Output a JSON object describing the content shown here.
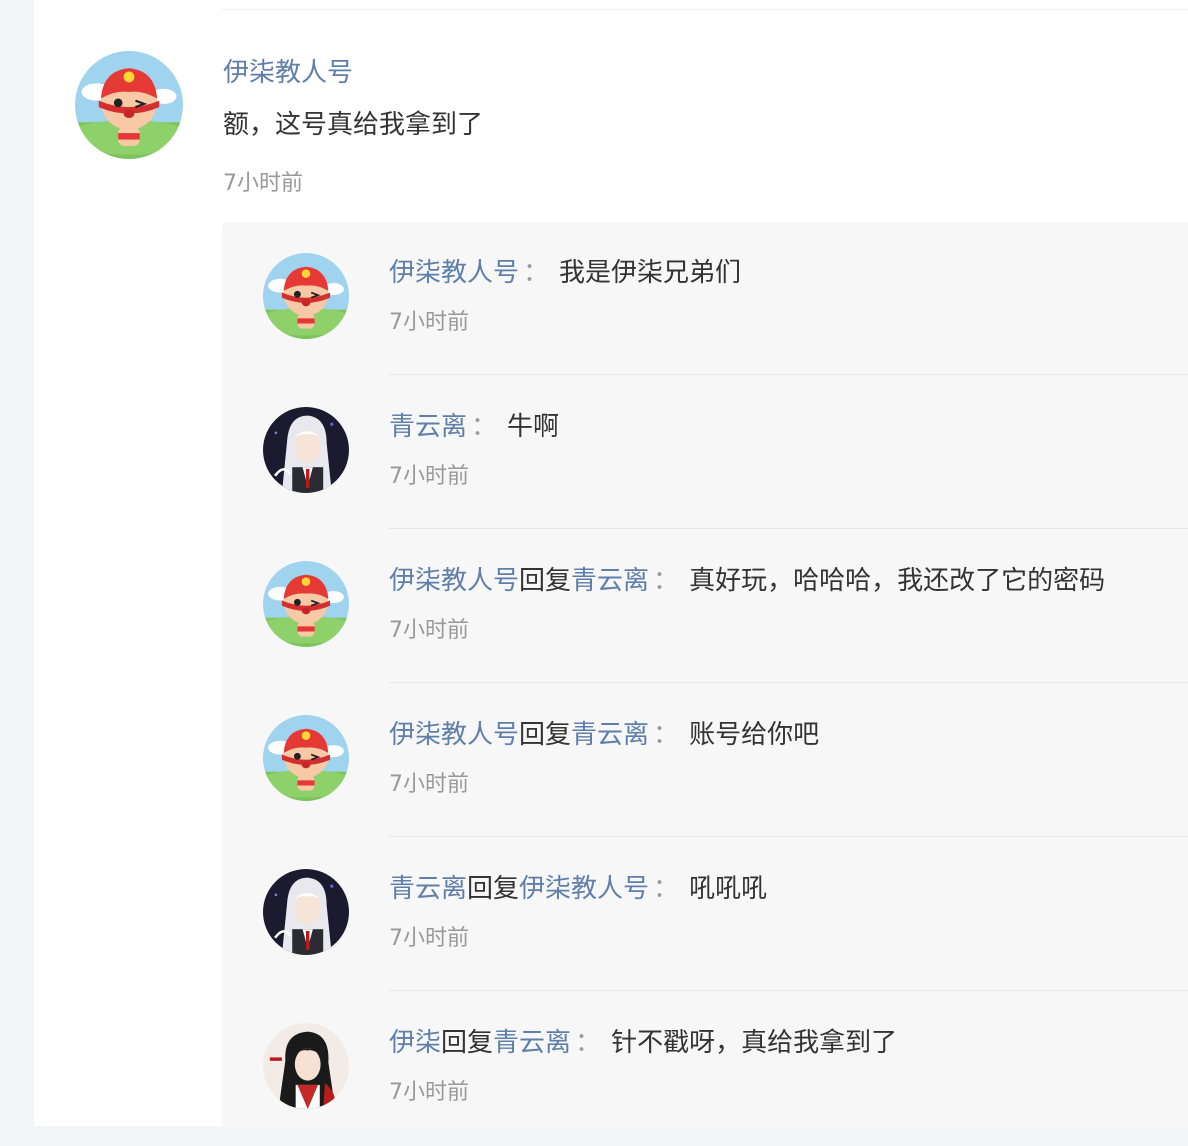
{
  "comment": {
    "author": "伊柒教人号",
    "content": "额，这号真给我拿到了",
    "time": "7小时前",
    "avatar_icon": "red-hat-mascot-avatar"
  },
  "replies": [
    {
      "author": "伊柒教人号",
      "reply_label": "",
      "reply_to": "",
      "separator": "：",
      "content": "我是伊柒兄弟们",
      "time": "7小时前",
      "avatar_icon": "red-hat-mascot-avatar"
    },
    {
      "author": "青云离",
      "reply_label": "",
      "reply_to": "",
      "separator": "：",
      "content": "牛啊",
      "time": "7小时前",
      "avatar_icon": "white-hair-anime-avatar"
    },
    {
      "author": "伊柒教人号",
      "reply_label": "回复",
      "reply_to": "青云离",
      "separator": "：",
      "content": "真好玩，哈哈哈，我还改了它的密码",
      "time": "7小时前",
      "avatar_icon": "red-hat-mascot-avatar"
    },
    {
      "author": "伊柒教人号",
      "reply_label": "回复",
      "reply_to": "青云离",
      "separator": "：",
      "content": "账号给你吧",
      "time": "7小时前",
      "avatar_icon": "red-hat-mascot-avatar"
    },
    {
      "author": "青云离",
      "reply_label": "回复",
      "reply_to": "伊柒教人号",
      "separator": "：",
      "content": "吼吼吼",
      "time": "7小时前",
      "avatar_icon": "white-hair-anime-avatar"
    },
    {
      "author": "伊柒",
      "reply_label": "回复",
      "reply_to": "青云离",
      "separator": "：",
      "content": "针不戳呀，真给我拿到了",
      "time": "7小时前",
      "avatar_icon": "dark-hair-anime-avatar"
    }
  ],
  "colors": {
    "username": "#5f7faa",
    "text": "#333333",
    "muted": "#999999",
    "reply_bg": "#f7f7f7"
  }
}
